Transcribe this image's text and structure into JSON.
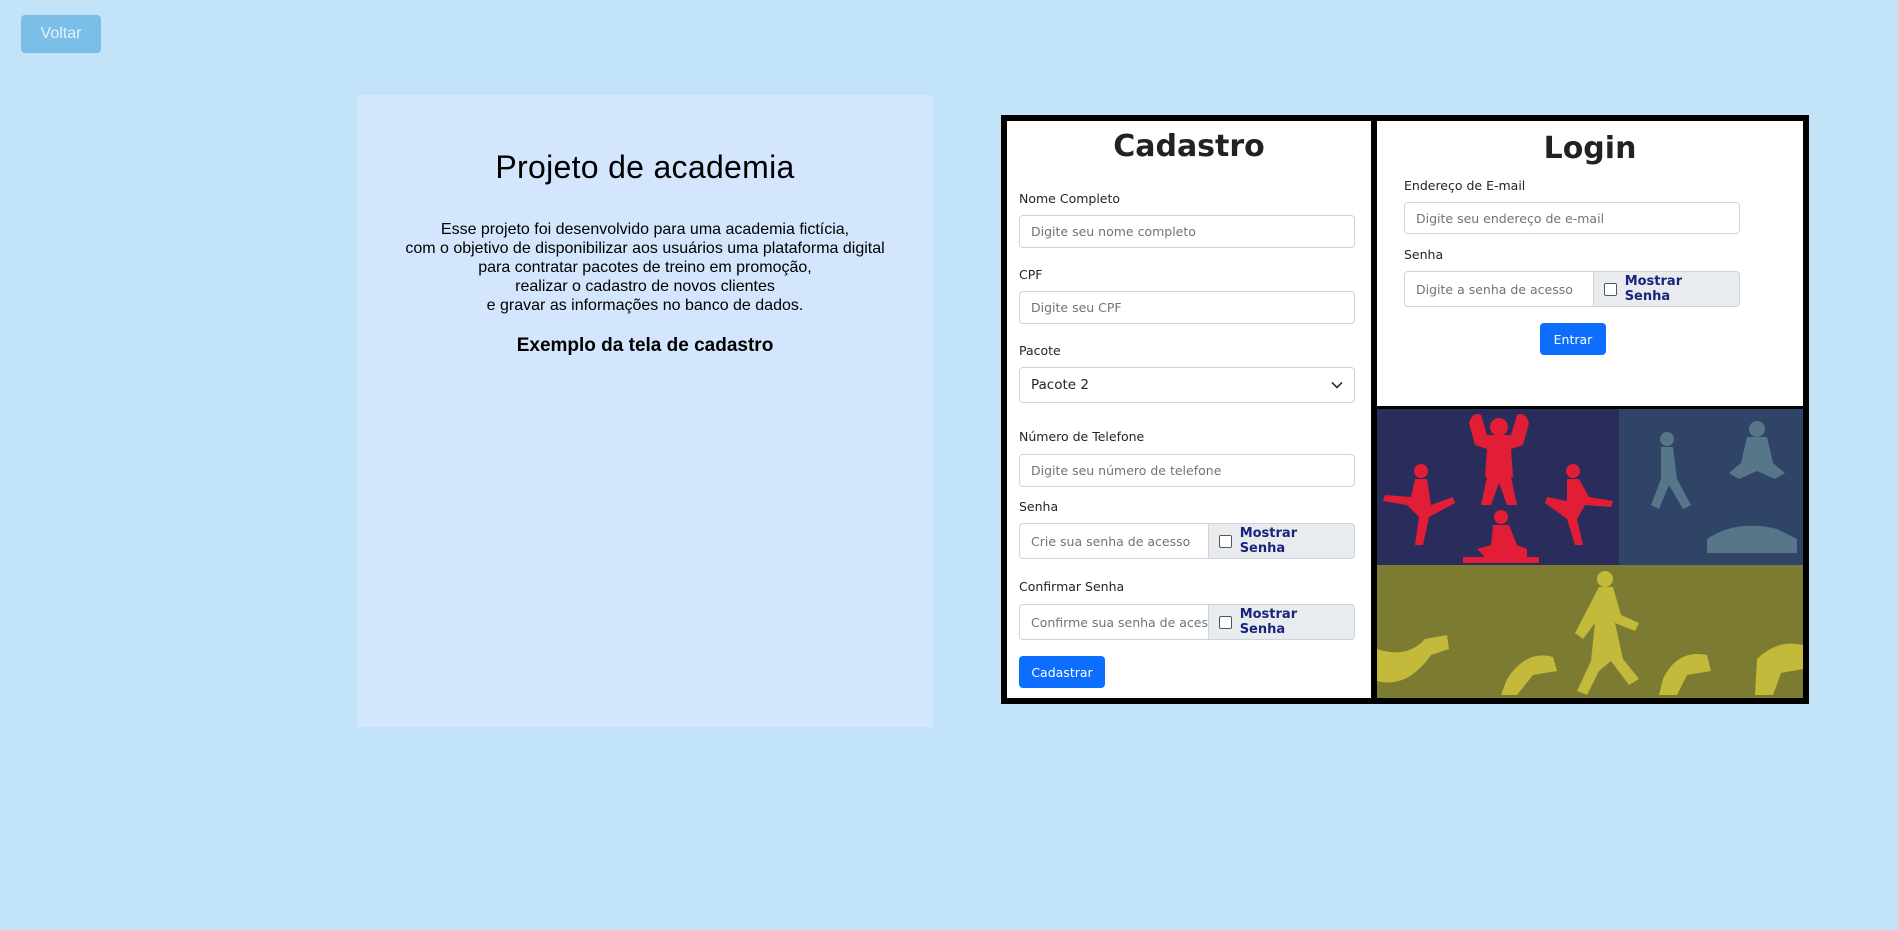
{
  "back_button": {
    "label": "Voltar"
  },
  "info": {
    "title": "Projeto de academia",
    "description_lines": [
      "Esse projeto foi desenvolvido para uma academia fictícia,",
      "com o objetivo de disponibilizar aos usuários uma plataforma digital",
      "para contratar pacotes de treino em promoção,",
      "realizar o cadastro de novos clientes",
      "e gravar as informações no banco de dados."
    ],
    "subtitle": "Exemplo da tela de cadastro"
  },
  "cadastro": {
    "title": "Cadastro",
    "nome": {
      "label": "Nome Completo",
      "placeholder": "Digite seu nome completo"
    },
    "cpf": {
      "label": "CPF",
      "placeholder": "Digite seu CPF"
    },
    "pacote": {
      "label": "Pacote",
      "value": "Pacote 2"
    },
    "telefone": {
      "label": "Número de Telefone",
      "placeholder": "Digite seu número de telefone"
    },
    "senha": {
      "label": "Senha",
      "placeholder": "Crie sua senha de acesso",
      "toggle_label": "Mostrar Senha"
    },
    "confirmar": {
      "label": "Confirmar Senha",
      "placeholder": "Confirme sua senha de acesso",
      "toggle_label": "Mostrar Senha"
    },
    "submit_label": "Cadastrar"
  },
  "login": {
    "title": "Login",
    "email": {
      "label": "Endereço de E-mail",
      "placeholder": "Digite seu endereço de e-mail"
    },
    "senha": {
      "label": "Senha",
      "placeholder": "Digite a senha de acesso",
      "toggle_label": "Mostrar Senha"
    },
    "submit_label": "Entrar"
  },
  "colors": {
    "page_bg": "#c3e4f8",
    "panel_bg": "#d4e6fd",
    "primary": "#0d6efd",
    "back_button": "#7bbfe8"
  }
}
